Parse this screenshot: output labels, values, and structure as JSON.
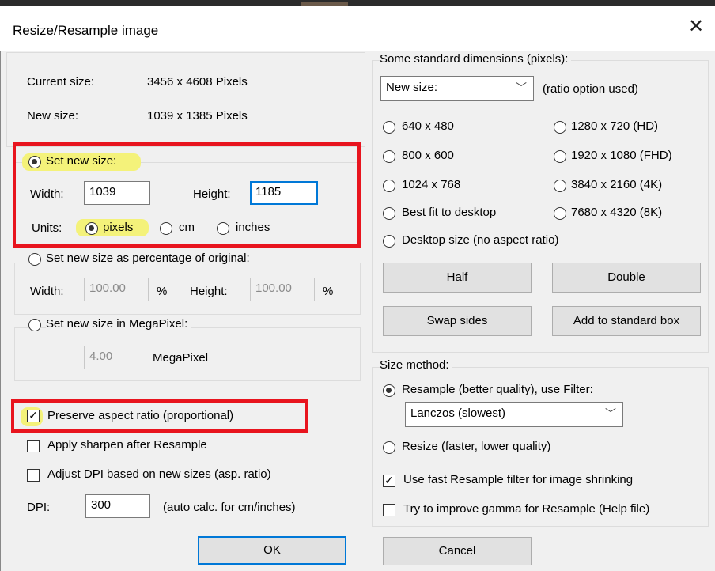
{
  "window": {
    "title": "Resize/Resample image",
    "close_glyph": "✕"
  },
  "current_size": {
    "label": "Current size:",
    "value": "3456  x  4608  Pixels"
  },
  "new_size": {
    "label": "New size:",
    "value": "1039  x  1385  Pixels"
  },
  "set_new_size": {
    "label": "Set new size:",
    "width_label": "Width:",
    "width_value": "1039",
    "height_label": "Height:",
    "height_value": "1185",
    "units_label": "Units:",
    "units": [
      "pixels",
      "cm",
      "inches"
    ],
    "selected_unit": "pixels"
  },
  "percentage": {
    "label": "Set new size as percentage of original:",
    "width_label": "Width:",
    "width_value": "100.00",
    "width_unit": "%",
    "height_label": "Height:",
    "height_value": "100.00",
    "height_unit": "%"
  },
  "megapixel": {
    "label": "Set new size in MegaPixel:",
    "value": "4.00",
    "unit": "MegaPixel"
  },
  "options": {
    "preserve": "Preserve aspect ratio (proportional)",
    "sharpen": "Apply sharpen after Resample",
    "adjust_dpi": "Adjust DPI based on new sizes (asp. ratio)",
    "dpi_label": "DPI:",
    "dpi_value": "300",
    "dpi_note": "(auto calc. for cm/inches)"
  },
  "standard": {
    "group_label": "Some standard dimensions (pixels):",
    "dropdown_value": "New size:",
    "ratio_note": "(ratio option used)",
    "left": [
      "640 x 480",
      "800 x 600",
      "1024 x 768",
      "Best fit to desktop"
    ],
    "right": [
      "1280 x 720  (HD)",
      "1920 x 1080 (FHD)",
      "3840 x 2160 (4K)",
      "7680 x 4320 (8K)"
    ],
    "desktop": "Desktop size (no aspect ratio)",
    "buttons": {
      "half": "Half",
      "double": "Double",
      "swap": "Swap sides",
      "add": "Add to standard box"
    }
  },
  "method": {
    "group_label": "Size method:",
    "resample": "Resample (better quality), use Filter:",
    "filter": "Lanczos (slowest)",
    "resize": "Resize (faster, lower quality)",
    "fast_filter": "Use fast Resample filter for image shrinking",
    "gamma": "Try to improve gamma for Resample (Help file)"
  },
  "footer": {
    "ok": "OK",
    "cancel": "Cancel"
  },
  "colors": {
    "highlight": "#f4f27a",
    "annotation_red": "#e8141e",
    "focus_blue": "#0078d7"
  }
}
